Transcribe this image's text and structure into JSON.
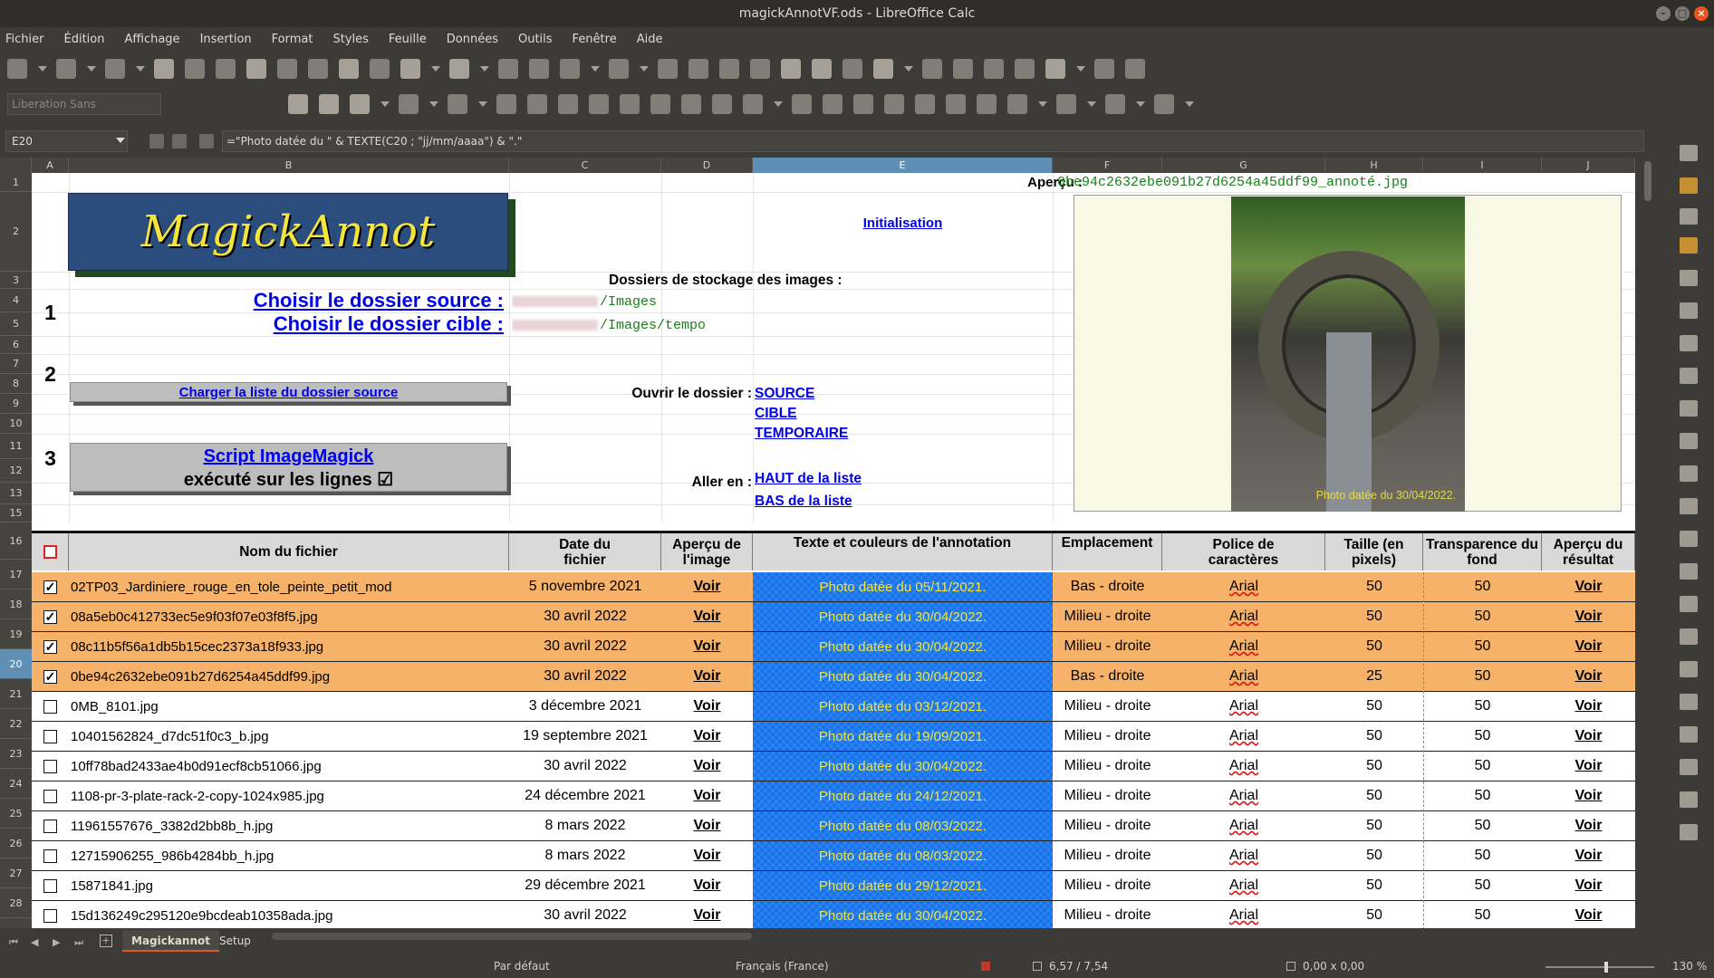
{
  "window": {
    "title": "magickAnnotVF.ods - LibreOffice Calc"
  },
  "menu": [
    "Fichier",
    "Édition",
    "Affichage",
    "Insertion",
    "Format",
    "Styles",
    "Feuille",
    "Données",
    "Outils",
    "Fenêtre",
    "Aide"
  ],
  "font_box": "Liberation Sans",
  "formula_bar": {
    "cell_ref": "E20",
    "formula": "=\"Photo datée du \" & TEXTE(C20 ; \"jj/mm/aaaa\") & \".\""
  },
  "columns": [
    "A",
    "B",
    "C",
    "D",
    "E",
    "F",
    "G",
    "H",
    "I",
    "J"
  ],
  "rows": [
    "1",
    "2",
    "3",
    "4",
    "5",
    "6",
    "7",
    "8",
    "9",
    "10",
    "11",
    "12",
    "13",
    "15",
    "16",
    "17",
    "18",
    "19",
    "20",
    "21",
    "22",
    "23",
    "24",
    "25",
    "26",
    "27",
    "28"
  ],
  "panel": {
    "logo": "MagickAnnot",
    "apercu_label": "Aperçu :",
    "apercu_file": "0be94c2632ebe091b27d6254a45ddf99_annoté.jpg",
    "initialisation": "Initialisation",
    "dossiers_label": "Dossiers de stockage des images :",
    "step1": "1",
    "step2": "2",
    "step3": "3",
    "choisir_source": "Choisir le dossier source :",
    "choisir_cible": "Choisir le dossier cible :",
    "source_path": "/Images",
    "cible_path": "/Images/tempo",
    "charger": "Charger la liste du dossier source",
    "ouvrir_label": "Ouvrir le dossier :",
    "ouvrir_source": "SOURCE",
    "ouvrir_cible": "CIBLE",
    "ouvrir_temp": "TEMPORAIRE",
    "script_link": "Script ImageMagick",
    "script_sub": "exécuté sur les lignes ☑",
    "aller_label": "Aller en :",
    "haut": "HAUT de la liste",
    "bas": "BAS de la liste",
    "preview_caption": "Photo datée du 30/04/2022."
  },
  "table": {
    "headers": [
      "Nom du fichier",
      "Date du fichier",
      "Aperçu de l'image",
      "Texte et couleurs de l'annotation",
      "Emplacement",
      "Police de caractères",
      "Taille (en pixels)",
      "Transparence du fond",
      "Aperçu du résultat"
    ],
    "rows": [
      {
        "checked": true,
        "name": "02TP03_Jardiniere_rouge_en_tole_peinte_petit_mod",
        "date": "5 novembre 2021",
        "voir": "Voir",
        "text": "Photo datée du 05/11/2021.",
        "place": "Bas - droite",
        "font": "Arial",
        "size": "50",
        "transp": "50",
        "result": "Voir"
      },
      {
        "checked": true,
        "name": "08a5eb0c412733ec5e9f03f07e03f8f5.jpg",
        "date": "30 avril 2022",
        "voir": "Voir",
        "text": "Photo datée du 30/04/2022.",
        "place": "Milieu - droite",
        "font": "Arial",
        "size": "50",
        "transp": "50",
        "result": "Voir"
      },
      {
        "checked": true,
        "name": "08c11b5f56a1db5b15cec2373a18f933.jpg",
        "date": "30 avril 2022",
        "voir": "Voir",
        "text": "Photo datée du 30/04/2022.",
        "place": "Milieu - droite",
        "font": "Arial",
        "size": "50",
        "transp": "50",
        "result": "Voir"
      },
      {
        "checked": true,
        "name": "0be94c2632ebe091b27d6254a45ddf99.jpg",
        "date": "30 avril 2022",
        "voir": "Voir",
        "text": "Photo datée du 30/04/2022.",
        "place": "Bas - droite",
        "font": "Arial",
        "size": "25",
        "transp": "50",
        "result": "Voir"
      },
      {
        "checked": false,
        "name": "0MB_8101.jpg",
        "date": "3 décembre 2021",
        "voir": "Voir",
        "text": "Photo datée du 03/12/2021.",
        "place": "Milieu - droite",
        "font": "Arial",
        "size": "50",
        "transp": "50",
        "result": "Voir"
      },
      {
        "checked": false,
        "name": "10401562824_d7dc51f0c3_b.jpg",
        "date": "19 septembre 2021",
        "voir": "Voir",
        "text": "Photo datée du 19/09/2021.",
        "place": "Milieu - droite",
        "font": "Arial",
        "size": "50",
        "transp": "50",
        "result": "Voir"
      },
      {
        "checked": false,
        "name": "10ff78bad2433ae4b0d91ecf8cb51066.jpg",
        "date": "30 avril 2022",
        "voir": "Voir",
        "text": "Photo datée du 30/04/2022.",
        "place": "Milieu - droite",
        "font": "Arial",
        "size": "50",
        "transp": "50",
        "result": "Voir"
      },
      {
        "checked": false,
        "name": "1108-pr-3-plate-rack-2-copy-1024x985.jpg",
        "date": "24 décembre 2021",
        "voir": "Voir",
        "text": "Photo datée du 24/12/2021.",
        "place": "Milieu - droite",
        "font": "Arial",
        "size": "50",
        "transp": "50",
        "result": "Voir"
      },
      {
        "checked": false,
        "name": "11961557676_3382d2bb8b_h.jpg",
        "date": "8 mars 2022",
        "voir": "Voir",
        "text": "Photo datée du 08/03/2022.",
        "place": "Milieu - droite",
        "font": "Arial",
        "size": "50",
        "transp": "50",
        "result": "Voir"
      },
      {
        "checked": false,
        "name": "12715906255_986b4284bb_h.jpg",
        "date": "8 mars 2022",
        "voir": "Voir",
        "text": "Photo datée du 08/03/2022.",
        "place": "Milieu - droite",
        "font": "Arial",
        "size": "50",
        "transp": "50",
        "result": "Voir"
      },
      {
        "checked": false,
        "name": "15871841.jpg",
        "date": "29 décembre 2021",
        "voir": "Voir",
        "text": "Photo datée du 29/12/2021.",
        "place": "Milieu - droite",
        "font": "Arial",
        "size": "50",
        "transp": "50",
        "result": "Voir"
      },
      {
        "checked": false,
        "name": "15d136249c295120e9bcdeab10358ada.jpg",
        "date": "30 avril 2022",
        "voir": "Voir",
        "text": "Photo datée du 30/04/2022.",
        "place": "Milieu - droite",
        "font": "Arial",
        "size": "50",
        "transp": "50",
        "result": "Voir"
      }
    ]
  },
  "tabs": {
    "active": "Magickannot",
    "other": "Setup"
  },
  "status": {
    "style": "Par défaut",
    "language": "Français (France)",
    "position": "6,57 / 7,54",
    "size": "0,00 x 0,00",
    "zoom": "130 %"
  },
  "colors": {
    "checked_row": "#f7b26a",
    "annot_bg": "#1a73e8",
    "annot_text": "#f4e53b",
    "link": "#0000ee",
    "active_header": "#5f8fb5"
  }
}
